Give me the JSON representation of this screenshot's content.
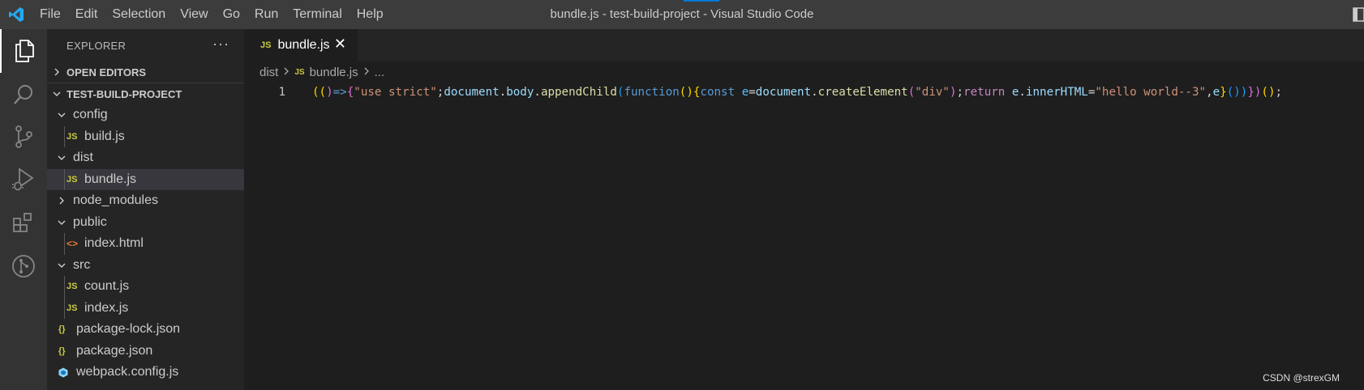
{
  "window": {
    "title": "bundle.js - test-build-project - Visual Studio Code",
    "menu": [
      "File",
      "Edit",
      "Selection",
      "View",
      "Go",
      "Run",
      "Terminal",
      "Help"
    ]
  },
  "sidebar": {
    "title": "EXPLORER",
    "more": "···",
    "open_editors": "OPEN EDITORS",
    "project": "TEST-BUILD-PROJECT",
    "tree": [
      {
        "label": "config",
        "type": "folder",
        "open": true,
        "depth": 1
      },
      {
        "label": "build.js",
        "type": "js",
        "depth": 2
      },
      {
        "label": "dist",
        "type": "folder",
        "open": true,
        "depth": 1
      },
      {
        "label": "bundle.js",
        "type": "js",
        "depth": 2,
        "selected": true
      },
      {
        "label": "node_modules",
        "type": "folder",
        "open": false,
        "depth": 1
      },
      {
        "label": "public",
        "type": "folder",
        "open": true,
        "depth": 1
      },
      {
        "label": "index.html",
        "type": "html",
        "depth": 2
      },
      {
        "label": "src",
        "type": "folder",
        "open": true,
        "depth": 1
      },
      {
        "label": "count.js",
        "type": "js",
        "depth": 2
      },
      {
        "label": "index.js",
        "type": "js",
        "depth": 2
      },
      {
        "label": "package-lock.json",
        "type": "json",
        "depth": 1
      },
      {
        "label": "package.json",
        "type": "json",
        "depth": 1
      },
      {
        "label": "webpack.config.js",
        "type": "webpack",
        "depth": 1
      }
    ]
  },
  "editor": {
    "tab": {
      "badge": "JS",
      "label": "bundle.js",
      "close": "✕"
    },
    "breadcrumb": {
      "folder": "dist",
      "badge": "JS",
      "file": "bundle.js",
      "more": "..."
    },
    "line_number": "1",
    "tokens": [
      {
        "t": "((",
        "c": "#ffd700"
      },
      {
        "t": ")",
        "c": "#da70d6"
      },
      {
        "t": "=>",
        "c": "#569cd6"
      },
      {
        "t": "{",
        "c": "#da70d6"
      },
      {
        "t": "\"use strict\"",
        "c": "#ce9178"
      },
      {
        "t": ";",
        "c": "#d4d4d4"
      },
      {
        "t": "document",
        "c": "#9cdcfe"
      },
      {
        "t": ".",
        "c": "#d4d4d4"
      },
      {
        "t": "body",
        "c": "#9cdcfe"
      },
      {
        "t": ".",
        "c": "#d4d4d4"
      },
      {
        "t": "appendChild",
        "c": "#dcdcaa"
      },
      {
        "t": "(",
        "c": "#179fff"
      },
      {
        "t": "function",
        "c": "#569cd6"
      },
      {
        "t": "(){",
        "c": "#ffd700"
      },
      {
        "t": "const",
        "c": "#569cd6"
      },
      {
        "t": " ",
        "c": "#d4d4d4"
      },
      {
        "t": "e",
        "c": "#4fc1ff"
      },
      {
        "t": "=",
        "c": "#d4d4d4"
      },
      {
        "t": "document",
        "c": "#9cdcfe"
      },
      {
        "t": ".",
        "c": "#d4d4d4"
      },
      {
        "t": "createElement",
        "c": "#dcdcaa"
      },
      {
        "t": "(",
        "c": "#da70d6"
      },
      {
        "t": "\"div\"",
        "c": "#ce9178"
      },
      {
        "t": ")",
        "c": "#da70d6"
      },
      {
        "t": ";",
        "c": "#d4d4d4"
      },
      {
        "t": "return",
        "c": "#c586c0"
      },
      {
        "t": " ",
        "c": "#d4d4d4"
      },
      {
        "t": "e",
        "c": "#9cdcfe"
      },
      {
        "t": ".",
        "c": "#d4d4d4"
      },
      {
        "t": "innerHTML",
        "c": "#9cdcfe"
      },
      {
        "t": "=",
        "c": "#d4d4d4"
      },
      {
        "t": "\"hello world--3\"",
        "c": "#ce9178"
      },
      {
        "t": ",",
        "c": "#d4d4d4"
      },
      {
        "t": "e",
        "c": "#9cdcfe"
      },
      {
        "t": "}",
        "c": "#ffd700"
      },
      {
        "t": "())",
        "c": "#179fff"
      },
      {
        "t": "})",
        "c": "#da70d6"
      },
      {
        "t": "()",
        "c": "#ffd700"
      },
      {
        "t": ";",
        "c": "#d4d4d4"
      }
    ]
  },
  "watermark": "CSDN @strexGM",
  "icons": {
    "logo": "vscode-logo-icon",
    "activity": [
      "files-icon",
      "search-icon",
      "source-control-icon",
      "run-debug-icon",
      "extensions-icon",
      "git-graph-icon"
    ]
  }
}
